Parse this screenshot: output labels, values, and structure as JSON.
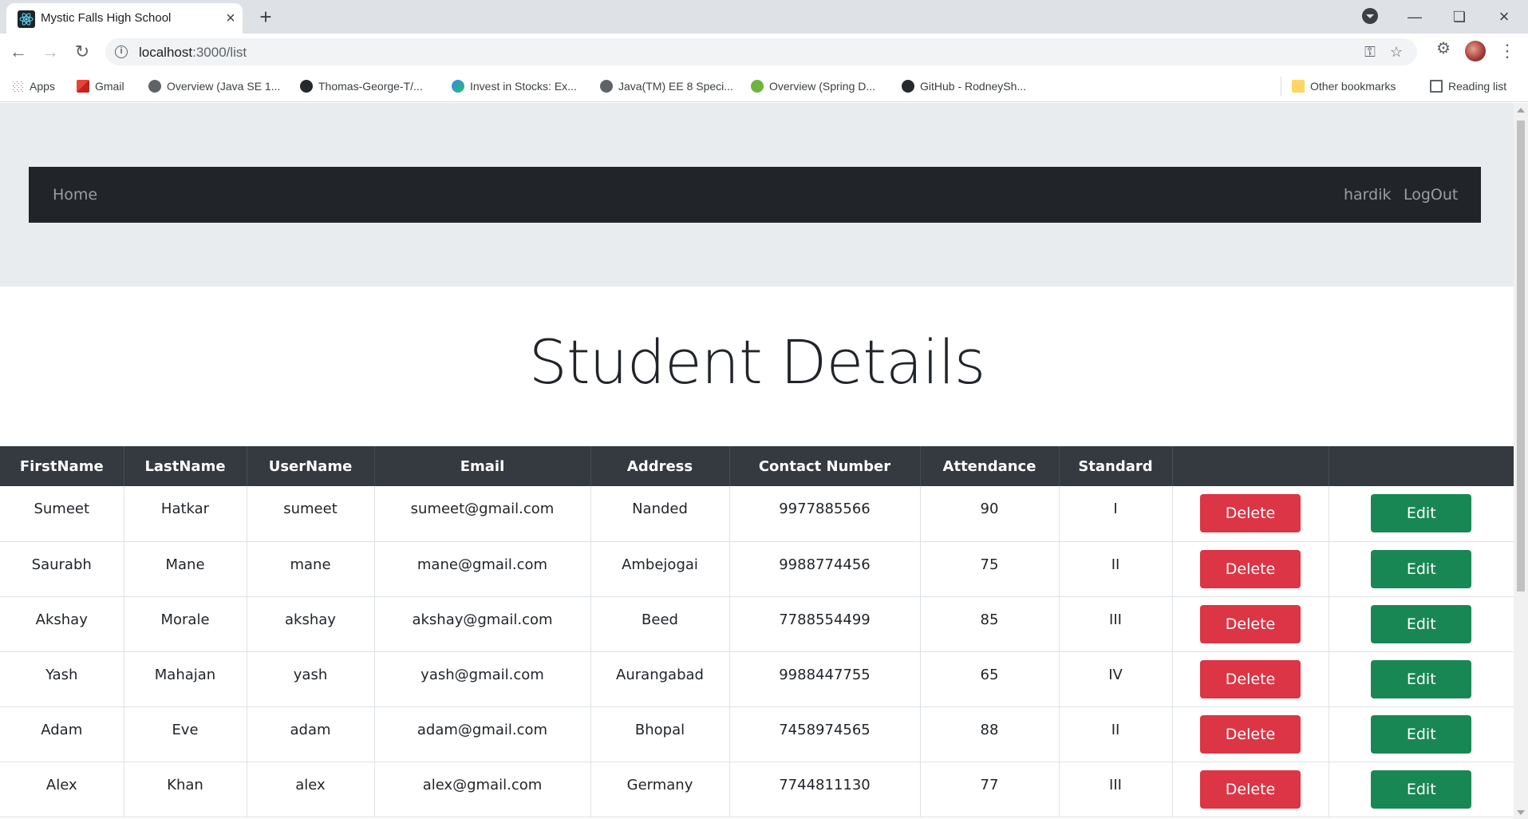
{
  "browser": {
    "tab_title": "Mystic Falls High School",
    "url_host": "localhost",
    "url_path": ":3000/list",
    "bookmarks": [
      {
        "label": "Apps"
      },
      {
        "label": "Gmail"
      },
      {
        "label": "Overview (Java SE 1..."
      },
      {
        "label": "Thomas-George-T/..."
      },
      {
        "label": "Invest in Stocks: Ex..."
      },
      {
        "label": "Java(TM) EE 8 Speci..."
      },
      {
        "label": "Overview (Spring D..."
      },
      {
        "label": "GitHub - RodneySh..."
      }
    ],
    "other_bookmarks": "Other bookmarks",
    "reading_list": "Reading list"
  },
  "navbar": {
    "home": "Home",
    "user": "hardik",
    "logout": "LogOut"
  },
  "page": {
    "title": "Student Details"
  },
  "table": {
    "headers": [
      "FirstName",
      "LastName",
      "UserName",
      "Email",
      "Address",
      "Contact Number",
      "Attendance",
      "Standard",
      "",
      ""
    ],
    "delete_label": "Delete",
    "edit_label": "Edit",
    "rows": [
      {
        "first": "Sumeet",
        "last": "Hatkar",
        "user": "sumeet",
        "email": "sumeet@gmail.com",
        "address": "Nanded",
        "contact": "9977885566",
        "attendance": "90",
        "standard": "I"
      },
      {
        "first": "Saurabh",
        "last": "Mane",
        "user": "mane",
        "email": "mane@gmail.com",
        "address": "Ambejogai",
        "contact": "9988774456",
        "attendance": "75",
        "standard": "II"
      },
      {
        "first": "Akshay",
        "last": "Morale",
        "user": "akshay",
        "email": "akshay@gmail.com",
        "address": "Beed",
        "contact": "7788554499",
        "attendance": "85",
        "standard": "III"
      },
      {
        "first": "Yash",
        "last": "Mahajan",
        "user": "yash",
        "email": "yash@gmail.com",
        "address": "Aurangabad",
        "contact": "9988447755",
        "attendance": "65",
        "standard": "IV"
      },
      {
        "first": "Adam",
        "last": "Eve",
        "user": "adam",
        "email": "adam@gmail.com",
        "address": "Bhopal",
        "contact": "7458974565",
        "attendance": "88",
        "standard": "II"
      },
      {
        "first": "Alex",
        "last": "Khan",
        "user": "alex",
        "email": "alex@gmail.com",
        "address": "Germany",
        "contact": "7744811130",
        "attendance": "77",
        "standard": "III"
      }
    ]
  },
  "colors": {
    "navbar_bg": "#212529",
    "jumbotron_bg": "#e9ecef",
    "table_header_bg": "#343a40",
    "delete_btn": "#dc3545",
    "edit_btn": "#198754"
  }
}
